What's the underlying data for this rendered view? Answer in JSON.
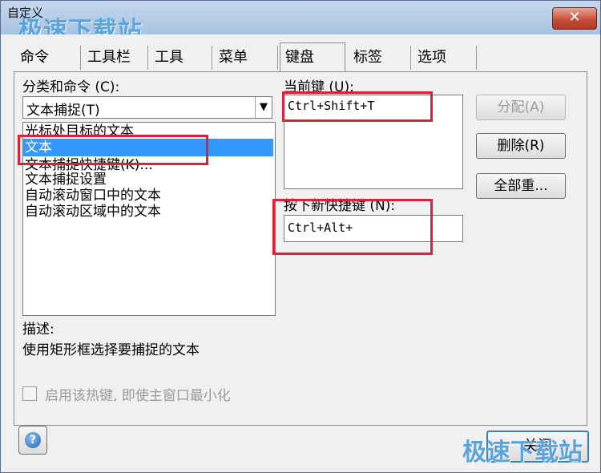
{
  "window": {
    "title": "自定义",
    "close_glyph": "✕"
  },
  "watermark": {
    "top": "极速下载站",
    "bottom": "极速下载站"
  },
  "tabs": [
    {
      "label": "命令"
    },
    {
      "label": "工具栏"
    },
    {
      "label": "工具"
    },
    {
      "label": "菜单"
    },
    {
      "label": "键盘"
    },
    {
      "label": "标签"
    },
    {
      "label": "选项"
    }
  ],
  "category": {
    "label": "分类和命令 (C):",
    "selected": "文本捕捉(T)",
    "arrow": "▼",
    "items": [
      {
        "label": "光标处目标的文本"
      },
      {
        "label": "文本"
      },
      {
        "label": "文本捕捉快捷键(K)..."
      },
      {
        "label": "文本捕捉设置"
      },
      {
        "label": "自动滚动窗口中的文本"
      },
      {
        "label": "自动滚动区域中的文本"
      }
    ]
  },
  "current_key": {
    "label": "当前键 (U):",
    "value": "Ctrl+Shift+T"
  },
  "new_shortcut": {
    "label": "按下新快捷键 (N):",
    "value": "Ctrl+Alt+"
  },
  "buttons": {
    "assign": "分配(A)",
    "delete": "删除(R)",
    "reset_all": "全部重..."
  },
  "description": {
    "label": "描述:",
    "text": "使用矩形框选择要捕捉的文本"
  },
  "checkbox": {
    "label": "启用该热键, 即使主窗口最小化",
    "checked": false
  },
  "help_glyph": "?",
  "close_button": "关闭",
  "colors": {
    "highlight": "#3399ff",
    "annotation": "#e0203a",
    "titlebar": "#b7cde6"
  }
}
